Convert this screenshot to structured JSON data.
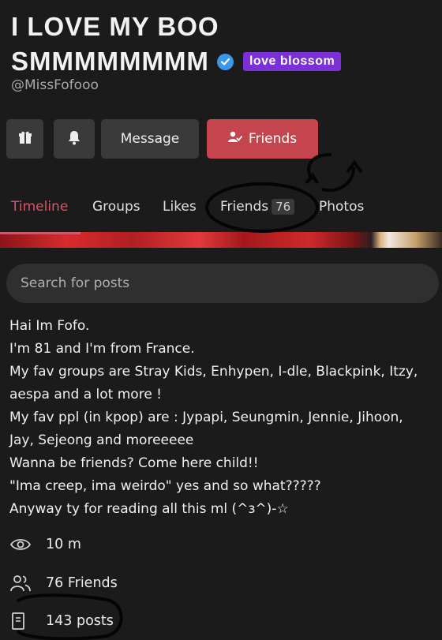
{
  "profile": {
    "title_line1": "I LOVE MY BOO",
    "title_line2": "SMMMMMMMM",
    "badge": "love blossom",
    "handle": "@MissFofooo"
  },
  "actions": {
    "message_label": "Message",
    "friends_label": "Friends"
  },
  "tabs": [
    {
      "label": "Timeline",
      "active": true
    },
    {
      "label": "Groups"
    },
    {
      "label": "Likes"
    },
    {
      "label": "Friends",
      "count": "76"
    },
    {
      "label": "Photos"
    }
  ],
  "search": {
    "placeholder": "Search for posts"
  },
  "bio": [
    "Hai Im Fofo.",
    "I'm 81 and I'm from France.",
    "My fav groups are Stray Kids, Enhypen, I-dle, Blackpink, Itzy,",
    "aespa and a lot more !",
    "My fav ppl (in kpop) are : Jypapi, Seungmin, Jennie, Jihoon,",
    "Jay, Sejeong and moreeeee",
    "Wanna be friends? Come here child!!",
    "\"Ima creep, ima weirdo\" yes and so what?????",
    "Anyway ty for reading all this ml (^з^)-☆"
  ],
  "stats": {
    "views": "10 m",
    "friends": "76 Friends",
    "posts": "143 posts"
  },
  "colors": {
    "accent": "#c5454f",
    "badge": "#7b2fd6",
    "verified": "#3a96e8"
  }
}
